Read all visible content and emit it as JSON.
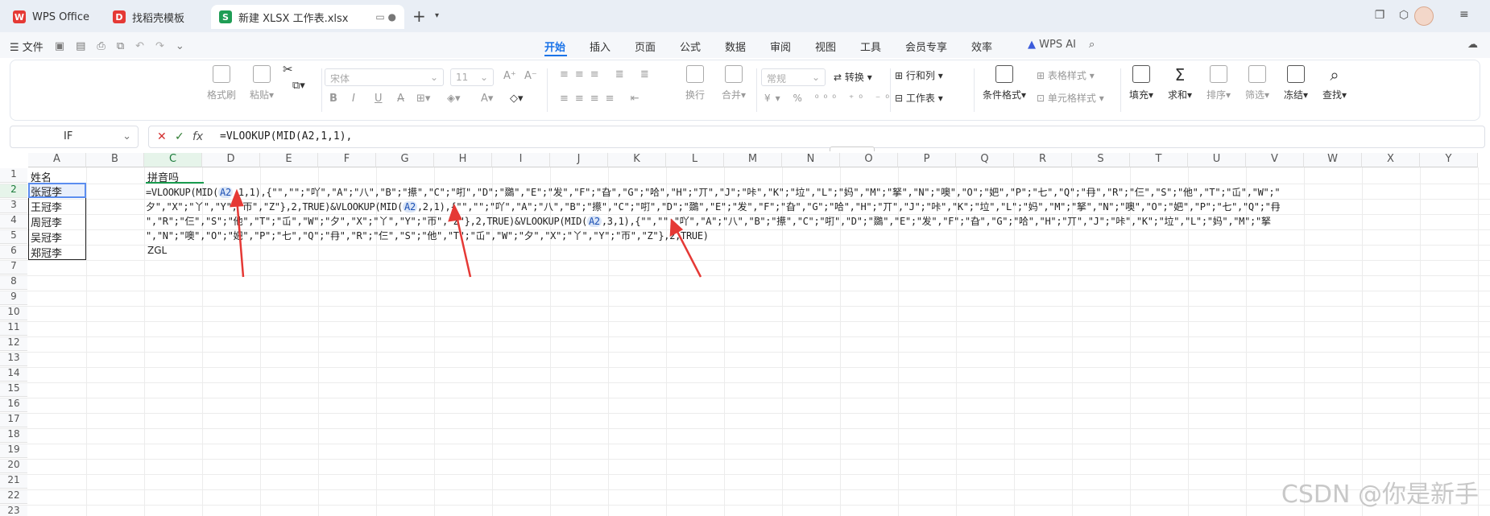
{
  "tabs": [
    {
      "label": "WPS Office",
      "icon": "wps-logo-icon"
    },
    {
      "label": "找稻壳模板",
      "icon": "docer-icon"
    },
    {
      "label": "新建 XLSX 工作表.xlsx",
      "icon": "spreadsheet-icon"
    }
  ],
  "menu": {
    "file": "文件",
    "items": [
      "开始",
      "插入",
      "页面",
      "公式",
      "数据",
      "审阅",
      "视图",
      "工具",
      "会员专享",
      "效率"
    ],
    "active": "开始",
    "wps_ai": "WPS AI"
  },
  "ribbon": {
    "format_painter": "格式刷",
    "paste": "粘贴",
    "font_name": "宋体",
    "font_size": "11",
    "wrap": "换行",
    "merge": "合并",
    "number_format": "常规",
    "convert": "转换",
    "row_col": "行和列",
    "worksheet": "工作表",
    "cond_format": "条件格式",
    "table_style": "表格样式",
    "cell_style": "单元格样式",
    "fill": "填充",
    "sum": "求和",
    "sort": "排序",
    "filter": "筛选",
    "freeze": "冻结",
    "find": "查找"
  },
  "formula_bar": {
    "name_box": "IF",
    "formula": "=VLOOKUP(MID(A2,1,1),"
  },
  "columns": [
    "A",
    "B",
    "C",
    "D",
    "E",
    "F",
    "G",
    "H",
    "I",
    "J",
    "K",
    "L",
    "M",
    "N",
    "O",
    "P",
    "Q",
    "R",
    "S",
    "T",
    "U",
    "V",
    "W",
    "X",
    "Y"
  ],
  "rows": [
    "1",
    "2",
    "3",
    "4",
    "5",
    "6",
    "7",
    "8",
    "9",
    "10",
    "11",
    "12",
    "13",
    "14",
    "15",
    "16",
    "17",
    "18",
    "19",
    "20",
    "21",
    "22",
    "23"
  ],
  "cells": {
    "A1": "姓名",
    "A2": "张冠李",
    "A3": "王冠李",
    "A4": "周冠李",
    "A5": "吴冠李",
    "A6": "郑冠李",
    "C1": "拼音吗",
    "C6": "ZGL"
  },
  "formula_lines": {
    "l1_a": "=VLOOKUP(MID(",
    "l1_ref": "A2",
    "l1_b": ",1,1),{\"\",\"\";\"吖\",\"A\";\"八\",\"B\";\"攃\",\"C\";\"咑\",\"D\";\"鵽\",\"E\";\"发\",\"F\";\"旮\",\"G\";\"哈\",\"H\";\"丌\",\"J\";\"咔\",\"K\";\"垃\",\"L\";\"妈\",\"M\";\"拏\",\"N\";\"噢\",\"O\";\"妑\",\"P\";\"七\",\"Q\";\"冄\",\"R\";\"仨\",\"S\";\"他\",\"T\";\"屲\",\"W\";\"",
    "l2_a": "夕\",\"X\";\"丫\",\"Y\";\"帀\",\"Z\"},2,TRUE)&VLOOKUP(MID(",
    "l2_ref": "A2",
    "l2_b": ",2,1),{\"\",\"\";\"吖\",\"A\";\"八\",\"B\";\"攃\",\"C\";\"咑\",\"D\";\"鵽\",\"E\";\"发\",\"F\";\"旮\",\"G\";\"哈\",\"H\";\"丌\",\"J\";\"咔\",\"K\";\"垃\",\"L\";\"妈\",\"M\";\"拏\",\"N\";\"噢\",\"O\";\"妑\",\"P\";\"七\",\"Q\";\"冄",
    "l3_a": "\",\"R\";\"仨\",\"S\";\"他\",\"T\";\"屲\",\"W\";\"夕\",\"X\";\"丫\",\"Y\";\"帀\",\"Z\"},2,TRUE)&VLOOKUP(MID(",
    "l3_ref": "A2",
    "l3_b": ",3,1),{\"\",\"\";\"吖\",\"A\";\"八\",\"B\";\"攃\",\"C\";\"咑\",\"D\";\"鵽\",\"E\";\"发\",\"F\";\"旮\",\"G\";\"哈\",\"H\";\"丌\",\"J\";\"咔\",\"K\";\"垃\",\"L\";\"妈\",\"M\";\"拏",
    "l4": "\",\"N\";\"噢\",\"O\";\"妑\",\"P\";\"七\",\"Q\";\"冄\",\"R\";\"仨\",\"S\";\"他\",\"T\";\"屲\",\"W\";\"夕\",\"X\";\"丫\",\"Y\";\"帀\",\"Z\"},2,TRUE)"
  },
  "watermark": "CSDN @你是新手",
  "colors": {
    "accent": "#1a73e8",
    "arrow": "#e53935",
    "ref_bg": "#dbe6f7"
  }
}
